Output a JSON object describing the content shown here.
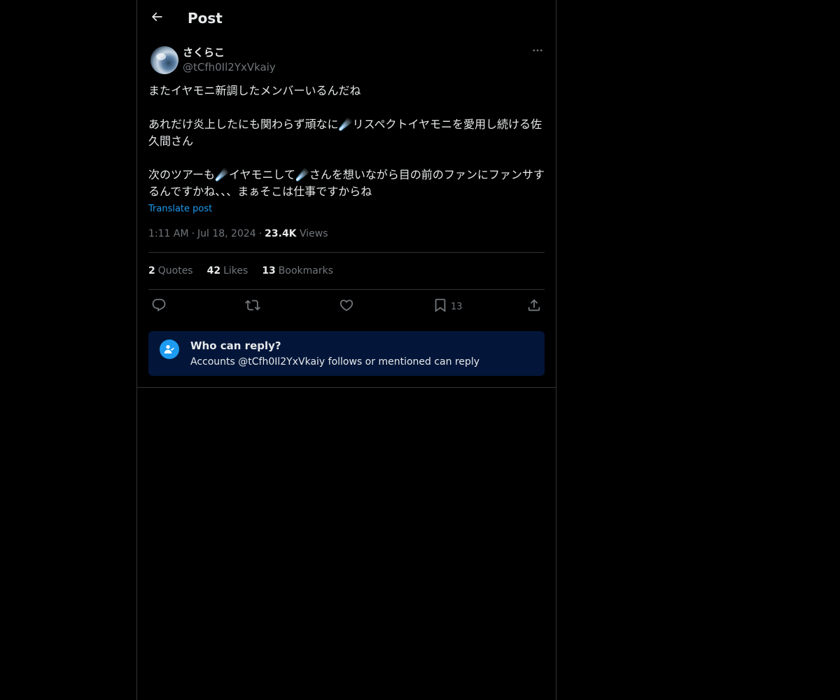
{
  "header": {
    "title": "Post",
    "back_icon": "arrow-left-icon"
  },
  "author": {
    "display_name": "さくらこ",
    "handle": "@tCfh0Il2YxVkaiy",
    "more_icon": "more-horizontal-icon"
  },
  "post": {
    "text": "またイヤモニ新調したメンバーいるんだね\n\nあれだけ炎上したにも関わらず頑なに☄️リスペクトイヤモニを愛用し続ける佐久間さん\n\n次のツアーも☄️イヤモニして☄️さんを想いながら目の前のファンにファンサするんですかね、、、まぁそこは仕事ですからね",
    "translate_label": "Translate post",
    "time": "1:11 AM",
    "date": "Jul 18, 2024",
    "views_count": "23.4K",
    "views_label": "Views"
  },
  "stats": {
    "quotes_count": "2",
    "quotes_label": "Quotes",
    "likes_count": "42",
    "likes_label": "Likes",
    "bookmarks_count": "13",
    "bookmarks_label": "Bookmarks"
  },
  "actions": {
    "reply_icon": "reply-icon",
    "repost_icon": "repost-icon",
    "like_icon": "heart-icon",
    "bookmark_icon": "bookmark-icon",
    "bookmark_count": "13",
    "share_icon": "share-icon"
  },
  "who_can_reply": {
    "title": "Who can reply?",
    "description": "Accounts @tCfh0Il2YxVkaiy follows or mentioned can reply",
    "icon": "user-check-icon"
  },
  "colors": {
    "background": "#000000",
    "text": "#e7e9ea",
    "muted": "#71767b",
    "accent": "#1d9bf0",
    "border": "#2f3336",
    "reply_box_bg": "#031639"
  }
}
